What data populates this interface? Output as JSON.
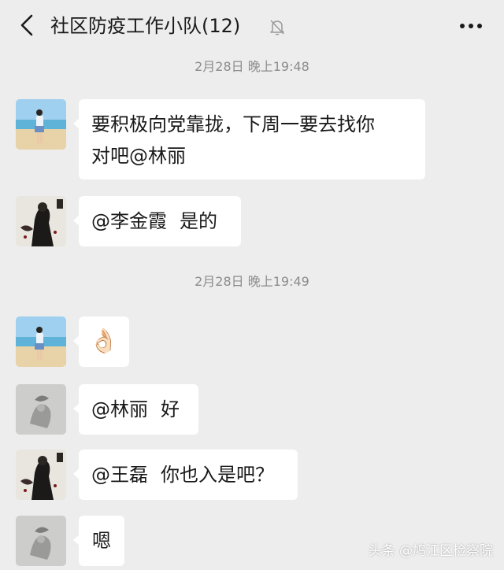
{
  "header": {
    "title": "社区防疫工作小队(12)",
    "back_icon": "chevron-left-icon",
    "mute_icon": "bell-muted-icon",
    "more_icon": "more-horizontal-icon"
  },
  "messages": {
    "time1": "2月28日 晚上19:48",
    "time2": "2月28日 晚上19:49",
    "m1": {
      "line1": "要积极向党靠拢，下周一要去找你",
      "line2": "对吧@林丽"
    },
    "m2": {
      "mention": "@李金霞",
      "text": "是的"
    },
    "m3": {
      "emoji": "👌🏻"
    },
    "m4": {
      "mention": "@林丽",
      "text": "好"
    },
    "m5": {
      "mention": "@王磊",
      "text": "你也入是吧？"
    },
    "m6": {
      "text": "嗯"
    }
  },
  "watermark": "头条 @鸠江区检察院",
  "colors": {
    "background": "#ededed",
    "bubble": "#ffffff",
    "timestamp": "#8c8c8c",
    "text": "#191919"
  }
}
